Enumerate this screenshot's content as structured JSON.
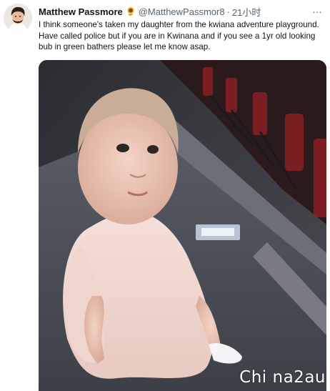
{
  "tweet": {
    "author": {
      "display_name": "Matthew Passmore",
      "emoji": "🌻",
      "handle": "@MatthewPassmor8",
      "separator": "·",
      "time": "21小时"
    },
    "more_icon": "…",
    "text": "I think someone's taken my daughter from the kwiana adventure playground. Have called police but if you are in Kwinana and if you see a 1yr old looking bub in green bathers please let me know asap.",
    "media": {
      "icon": "photo"
    }
  },
  "watermark": "Chi na2au"
}
